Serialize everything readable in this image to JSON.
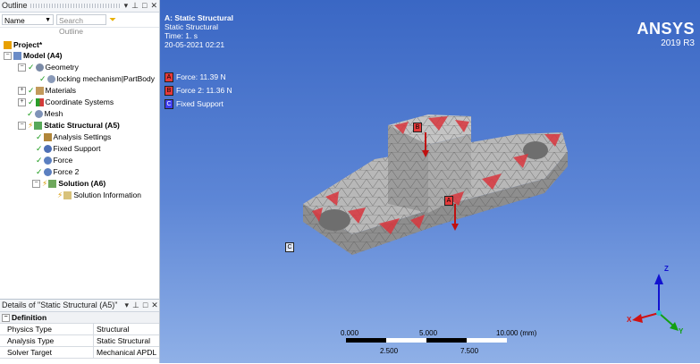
{
  "outline": {
    "title": "Outline",
    "controls": {
      "dropdown": "▾",
      "pin": "⊥",
      "maximize": "□",
      "close": "✕"
    },
    "name_filter": "Name",
    "search_placeholder": "Search Outline",
    "tree": {
      "project": "Project*",
      "model": "Model (A4)",
      "geometry": "Geometry",
      "part_body": "locking mechanism|PartBody",
      "materials": "Materials",
      "coordinate_systems": "Coordinate Systems",
      "mesh": "Mesh",
      "static_structural": "Static Structural (A5)",
      "analysis_settings": "Analysis Settings",
      "fixed_support": "Fixed Support",
      "force": "Force",
      "force2": "Force 2",
      "solution": "Solution (A6)",
      "solution_information": "Solution Information"
    }
  },
  "details": {
    "title": "Details of \"Static Structural (A5)\"",
    "section": "Definition",
    "rows": [
      {
        "key": "Physics Type",
        "value": "Structural"
      },
      {
        "key": "Analysis Type",
        "value": "Static Structural"
      },
      {
        "key": "Solver Target",
        "value": "Mechanical APDL"
      }
    ]
  },
  "viewport": {
    "analysis_title": "A: Static Structural",
    "subtitle": "Static Structural",
    "time": "Time: 1. s",
    "date": "20-05-2021 02:21",
    "legend": [
      {
        "tag": "A",
        "label": "Force: 11.39 N",
        "color": "#e53a3a"
      },
      {
        "tag": "B",
        "label": "Force 2: 11.36 N",
        "color": "#e53a3a"
      },
      {
        "tag": "C",
        "label": "Fixed Support",
        "color": "#3d3df0"
      }
    ],
    "brand": "ANSYS",
    "version": "2019 R3",
    "scale": {
      "labels_top": [
        "0.000",
        "5.000",
        "10.000 (mm)"
      ],
      "labels_bottom": [
        "2.500",
        "7.500"
      ]
    },
    "triad": {
      "x": "X",
      "y": "Y",
      "z": "Z"
    },
    "model_tags": {
      "a": "A",
      "b": "B",
      "c": "C"
    }
  }
}
